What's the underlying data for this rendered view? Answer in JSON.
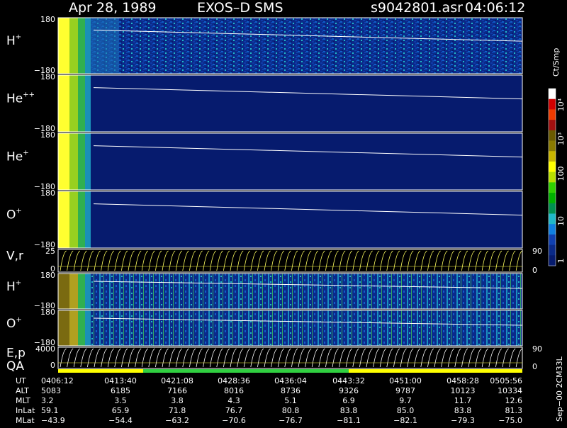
{
  "header": {
    "date": "Apr 28, 1989",
    "instrument": "EXOS–D SMS",
    "file": "s9042801.asr",
    "time": "04:06:12"
  },
  "colorbar": {
    "unit": "Ct/Smp",
    "labels": [
      "10⁴",
      "10³",
      "100",
      "10",
      "1"
    ],
    "colors": [
      "#ffffff",
      "#d00000",
      "#ee3b00",
      "#a01010",
      "#6a5a00",
      "#8a7a00",
      "#c8b400",
      "#ffff00",
      "#b8e000",
      "#30d000",
      "#00b000",
      "#009050",
      "#20b8c8",
      "#1080e0",
      "#1040b0",
      "#0a2a88",
      "#061b6e"
    ]
  },
  "panels": [
    {
      "ion": "H",
      "charge": "+",
      "ymax": "180",
      "ymin": "−180"
    },
    {
      "ion": "He",
      "charge": "++",
      "ymax": "180",
      "ymin": "−180"
    },
    {
      "ion": "He",
      "charge": "+",
      "ymax": "180",
      "ymin": "−180"
    },
    {
      "ion": "O",
      "charge": "+",
      "ymax": "180",
      "ymin": "−180"
    },
    {
      "ion": "V,r",
      "charge": "",
      "ymax": "25",
      "ymin": "0",
      "right_top": "90",
      "right_bottom": "0"
    },
    {
      "ion": "H",
      "charge": "+",
      "ymax": "180",
      "ymin": "−180"
    },
    {
      "ion": "O",
      "charge": "+",
      "ymax": "180",
      "ymin": "−180"
    },
    {
      "ion": "E,p",
      "charge": "",
      "ymax": "4000",
      "ymin": "0",
      "right_top": "90",
      "right_bottom": "0"
    }
  ],
  "qa_label": "QA",
  "footer_note": "Sep−00  2CM33L",
  "table": {
    "rows": [
      {
        "label": "UT",
        "values": [
          "0406:12",
          "0413:40",
          "0421:08",
          "0428:36",
          "0436:04",
          "0443:32",
          "0451:00",
          "0458:28",
          "0505:56"
        ]
      },
      {
        "label": "ALT",
        "values": [
          "5083",
          "6185",
          "7166",
          "8016",
          "8736",
          "9326",
          "9787",
          "10123",
          "10334"
        ]
      },
      {
        "label": "MLT",
        "values": [
          "3.2",
          "3.5",
          "3.8",
          "4.3",
          "5.1",
          "6.9",
          "9.7",
          "11.7",
          "12.6"
        ]
      },
      {
        "label": "InLat",
        "values": [
          "59.1",
          "65.9",
          "71.8",
          "76.7",
          "80.8",
          "83.8",
          "85.0",
          "83.8",
          "81.3"
        ]
      },
      {
        "label": "MLat",
        "values": [
          "−43.9",
          "−54.4",
          "−63.2",
          "−70.6",
          "−76.7",
          "−81.1",
          "−82.1",
          "−79.3",
          "−75.0"
        ]
      }
    ]
  },
  "chart_data": {
    "type": "heatmap",
    "title": "Apr 28, 1989   EXOS–D SMS",
    "x_ticks": [
      "0406:12",
      "0413:40",
      "0421:08",
      "0428:36",
      "0436:04",
      "0443:32",
      "0451:00",
      "0458:28",
      "0505:56"
    ],
    "panels": [
      "H+",
      "He++",
      "He+",
      "O+",
      "V,r",
      "H+",
      "O+",
      "E,p"
    ],
    "y_range_angle": [
      -180,
      180
    ],
    "colorbar_unit": "Ct/Smp",
    "colorbar_range": [
      1,
      10000
    ],
    "colorbar_scale": "log"
  }
}
